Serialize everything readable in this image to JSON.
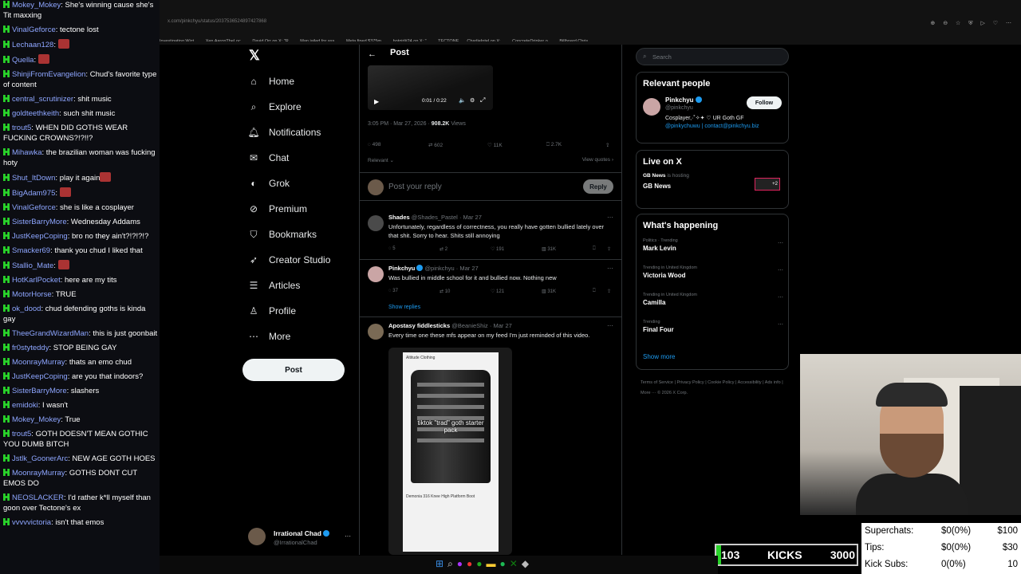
{
  "chat": {
    "messages": [
      {
        "user": "Mokey_Mokey",
        "text": "She's winning cause she's Tit maxxing"
      },
      {
        "user": "VinalGeforce",
        "text": "tectone lost"
      },
      {
        "user": "Lechaan128",
        "text": ""
      },
      {
        "user": "Quella",
        "text": ""
      },
      {
        "user": "ShinjiFromEvangelion",
        "text": "Chud's favorite type of content"
      },
      {
        "user": "central_scrutinizer",
        "text": "shit music"
      },
      {
        "user": "goldteethkeith",
        "text": "such shit music"
      },
      {
        "user": "trout5",
        "text": "WHEN DID GOTHS WEAR FUCKING CROWNS?!?!!?"
      },
      {
        "user": "Mihawka",
        "text": "the brazilian woman was fucking hoty"
      },
      {
        "user": "Shut_ItDown",
        "text": "play it again"
      },
      {
        "user": "BigAdam975",
        "text": ""
      },
      {
        "user": "VinalGeforce",
        "text": "she is like a cosplayer"
      },
      {
        "user": "SisterBarryMore",
        "text": "Wednesday Addams"
      },
      {
        "user": "JustKeepCoping",
        "text": "bro no they ain't?!?!?!?"
      },
      {
        "user": "Smacker69",
        "text": "thank you chud I liked that"
      },
      {
        "user": "Stallio_Mate",
        "text": ""
      },
      {
        "user": "HotKarlPocket",
        "text": "here are my tits"
      },
      {
        "user": "MotorHorse",
        "text": "TRUE"
      },
      {
        "user": "ok_dood",
        "text": "chud defending goths is kinda gay"
      },
      {
        "user": "TheeGrandWizardMan",
        "text": "this is just goonbait"
      },
      {
        "user": "fr0styteddy",
        "text": "STOP BEING GAY"
      },
      {
        "user": "MoonrayMurray",
        "text": "thats an emo chud"
      },
      {
        "user": "JustKeepCoping",
        "text": "are you that indoors?"
      },
      {
        "user": "SisterBarryMore",
        "text": "slashers"
      },
      {
        "user": "emidoki",
        "text": "I wasn't"
      },
      {
        "user": "Mokey_Mokey",
        "text": "True"
      },
      {
        "user": "trout5",
        "text": "GOTH DOESN'T MEAN GOTHIC YOU DUMB BITCH"
      },
      {
        "user": "Jstlk_GoonerArc",
        "text": "NEW AGE GOTH HOES"
      },
      {
        "user": "MoonrayMurray",
        "text": "GOTHS DONT CUT EMOS DO"
      },
      {
        "user": "NEOSLACKER",
        "text": "I'd rather k*ll myself than goon over Tectone's ex"
      },
      {
        "user": "vvvvvictoria",
        "text": "isn't that emos"
      }
    ],
    "emote_users": [
      2,
      3,
      9,
      10,
      15
    ]
  },
  "browser": {
    "url": "x.com/pinkchyu/status/2037536524897427868",
    "tabs": [
      "Investigating Wizt...",
      "Xen AaronTheLoc...",
      "David Orr on X: \"R...",
      "Man jailed for ass...",
      "Meta fined $375m...",
      "hotgirl#24 on X: \"...",
      "TECTONE",
      "CharlieIntel on X:...",
      "ConcreteDrinker o...",
      "Billboard Chris"
    ]
  },
  "nav": {
    "items": [
      {
        "label": "Home",
        "icon": "home-icon"
      },
      {
        "label": "Explore",
        "icon": "search-icon"
      },
      {
        "label": "Notifications",
        "icon": "bell-icon"
      },
      {
        "label": "Chat",
        "icon": "mail-icon"
      },
      {
        "label": "Grok",
        "icon": "grok-icon"
      },
      {
        "label": "Premium",
        "icon": "premium-icon"
      },
      {
        "label": "Bookmarks",
        "icon": "bookmark-icon"
      },
      {
        "label": "Creator Studio",
        "icon": "rocket-icon"
      },
      {
        "label": "Articles",
        "icon": "article-icon"
      },
      {
        "label": "Profile",
        "icon": "person-icon"
      },
      {
        "label": "More",
        "icon": "more-icon"
      }
    ],
    "post_label": "Post",
    "profile": {
      "name": "Irrational Chad",
      "handle": "@IrrationalChad"
    }
  },
  "post": {
    "header": "Post",
    "video_time": "0:01 / 0:22",
    "time": "3:05 PM · Mar 27, 2026 ·",
    "views": "908.2K",
    "views_label": "Views",
    "counts": {
      "replies": "498",
      "reposts": "602",
      "likes": "11K",
      "bookmarks": "2.7K"
    },
    "relevant": "Relevant",
    "view_quotes": "View quotes",
    "reply_placeholder": "Post your reply",
    "reply_button": "Reply"
  },
  "replies": [
    {
      "name": "Shades",
      "handle": "@Shades_Pastel",
      "date": "· Mar 27",
      "text": "Unfortunately, regardless of correctness, you really have gotten bullied lately over that shit. Sorry to hear. Shits still annoying",
      "stats": {
        "replies": "5",
        "reposts": "2",
        "likes": "191",
        "views": "31K"
      }
    },
    {
      "name": "Pinkchyu",
      "handle": "@pinkchyu",
      "date": "· Mar 27",
      "text": "Was bullied in middle school for it and bullied now. Nothing new",
      "stats": {
        "replies": "37",
        "reposts": "10",
        "likes": "121",
        "views": "31K"
      },
      "show_replies": "Show replies"
    },
    {
      "name": "Apostasy fiddlesticks",
      "handle": "@BeanieShiz",
      "date": "· Mar 27",
      "text": "Every time one these mfs appear on my feed I'm just reminded of this video.",
      "media_caption": "tiktok \"trad\" goth starter pack",
      "media_product": "Demonia 316 Knee High Platform Boot",
      "media_header": "Altitude Clothing"
    }
  ],
  "sidebar": {
    "search_placeholder": "Search",
    "relevant_people": {
      "title": "Relevant people",
      "name": "Pinkchyu",
      "handle": "@pinkchyu",
      "bio": "Cosplayer,·˚✧✦ ♡ UR Goth GF",
      "bio_links": "@pinkychuwu | contact@pinkchyu.biz",
      "follow": "Follow"
    },
    "live": {
      "title": "Live on X",
      "host": "GB News",
      "host_suffix": "is hosting",
      "name": "GB News",
      "extra": "+2"
    },
    "happening": {
      "title": "What's happening",
      "trends": [
        {
          "context": "Politics · Trending",
          "name": "Mark Levin"
        },
        {
          "context": "Trending in United Kingdom",
          "name": "Victoria Wood"
        },
        {
          "context": "Trending in United Kingdom",
          "name": "Camilla"
        },
        {
          "context": "Trending",
          "name": "Final Four"
        }
      ],
      "show_more": "Show more"
    },
    "footer": "Terms of Service  |  Privacy Policy  |  Cookie Policy  |  Accessibility  |  Ads info  |  More ···  © 2026 X Corp."
  },
  "stream": {
    "superchats_label": "Superchats:",
    "superchats_value": "$0(0%)",
    "superchats_goal": "$100",
    "tips_label": "Tips:",
    "tips_value": "$0(0%)",
    "tips_goal": "$30",
    "kicksubs_label": "Kick Subs:",
    "kicksubs_value": "0(0%)",
    "kicksubs_goal": "10",
    "kicks_count": "103",
    "kicks_label": "KICKS",
    "kicks_goal": "3000",
    "kicks_progress": 0.034
  },
  "colors": {
    "accent": "#1d9bf0",
    "kick_green": "#29d42a",
    "bg": "#000000"
  }
}
